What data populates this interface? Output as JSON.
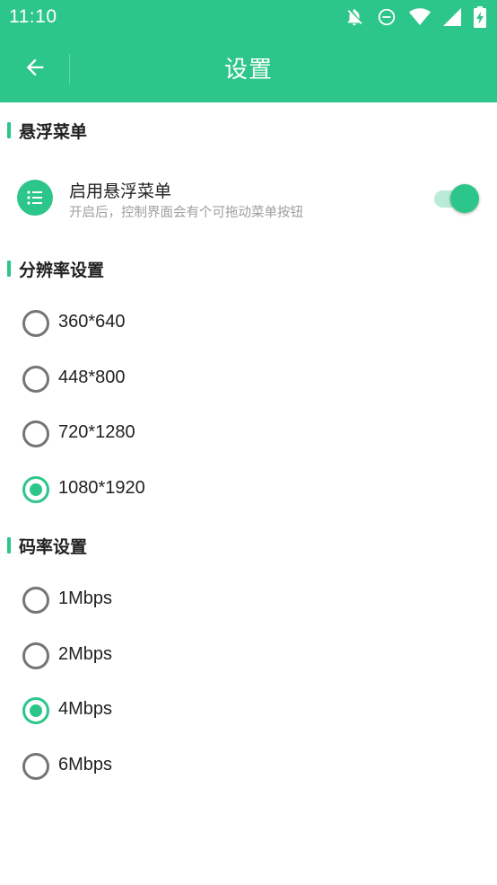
{
  "status_bar": {
    "time": "11:10",
    "icons": [
      "notifications-off-icon",
      "do-not-disturb-icon",
      "wifi-icon",
      "cell-signal-icon",
      "battery-charging-icon"
    ]
  },
  "toolbar": {
    "back_icon": "arrow-back-icon",
    "title": "设置"
  },
  "colors": {
    "accent": "#2dc68a",
    "switch_track": "#b9ebd6",
    "text_primary": "#212121",
    "text_secondary": "#9e9e9e",
    "radio_off": "#757575"
  },
  "floating_menu_section": {
    "title": "悬浮菜单",
    "item": {
      "icon": "list-icon",
      "title": "启用悬浮菜单",
      "summary": "开启后，控制界面会有个可拖动菜单按钮",
      "enabled": true
    }
  },
  "resolution_section": {
    "title": "分辨率设置",
    "options": [
      {
        "label": "360*640",
        "checked": false
      },
      {
        "label": "448*800",
        "checked": false
      },
      {
        "label": "720*1280",
        "checked": false
      },
      {
        "label": "1080*1920",
        "checked": true
      }
    ]
  },
  "bitrate_section": {
    "title": "码率设置",
    "options": [
      {
        "label": "1Mbps",
        "checked": false
      },
      {
        "label": "2Mbps",
        "checked": false
      },
      {
        "label": "4Mbps",
        "checked": true
      },
      {
        "label": "6Mbps",
        "checked": false
      }
    ]
  }
}
